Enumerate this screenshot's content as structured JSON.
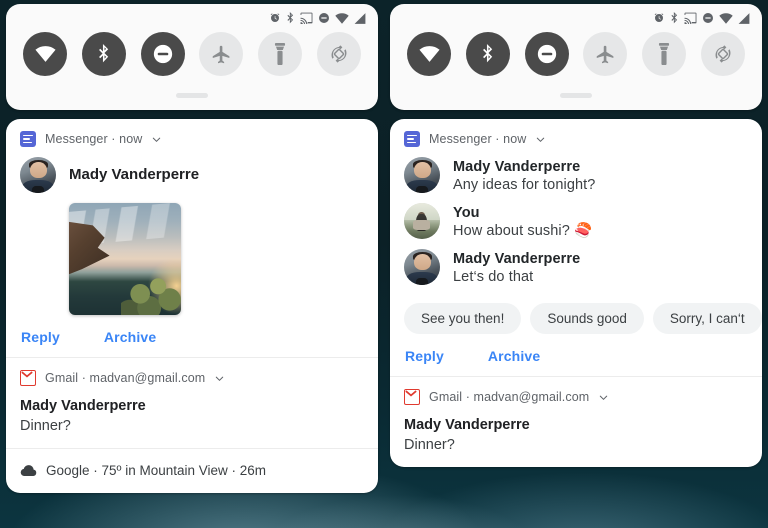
{
  "meta": {
    "accent_blue": "#3a85f6",
    "panel_bg": "#ffffff",
    "qs_bg": "#fafafa",
    "tile_on": "#4a4a4a",
    "tile_off": "#e6e7e8",
    "wallpaper": "#0b2227"
  },
  "statusbar": {
    "icons": [
      {
        "name": "alarm-icon",
        "label": "Alarm"
      },
      {
        "name": "bluetooth-icon",
        "label": "Bluetooth"
      },
      {
        "name": "cast-icon",
        "label": "Cast"
      },
      {
        "name": "do-not-disturb-icon",
        "label": "Do Not Disturb"
      },
      {
        "name": "wifi-icon",
        "label": "Wi-Fi"
      },
      {
        "name": "cell-signal-icon",
        "label": "Mobile signal"
      }
    ]
  },
  "quick_settings": {
    "tiles": [
      {
        "name": "wifi-tile",
        "label": "Wi-Fi",
        "state": "on"
      },
      {
        "name": "bluetooth-tile",
        "label": "Bluetooth",
        "state": "on"
      },
      {
        "name": "do-not-disturb-tile",
        "label": "Do Not Disturb",
        "state": "on"
      },
      {
        "name": "airplane-mode-tile",
        "label": "Airplane mode",
        "state": "off"
      },
      {
        "name": "flashlight-tile",
        "label": "Flashlight",
        "state": "off"
      },
      {
        "name": "auto-rotate-tile",
        "label": "Auto-rotate",
        "state": "off"
      }
    ],
    "drag_handle": "Expand quick settings"
  },
  "left_panel": {
    "messenger": {
      "app_name": "Messenger · now",
      "sender": "Mady Vanderperre",
      "attachment_alt": "Sunset over a cliff and valley",
      "actions": [
        {
          "name": "reply-action",
          "label": "Reply"
        },
        {
          "name": "archive-action",
          "label": "Archive"
        }
      ]
    },
    "gmail": {
      "app_name": "Gmail · madvan@gmail.com",
      "title": "Mady Vanderperre",
      "subject": "Dinner?"
    },
    "weather": {
      "text": "Google · 75º in Mountain View · 26m"
    }
  },
  "right_panel": {
    "messenger": {
      "app_name": "Messenger · now",
      "messages": [
        {
          "sender": "Mady Vanderperre",
          "body": "Any ideas for tonight?",
          "avatar": "mady"
        },
        {
          "sender": "You",
          "body": "How about sushi? 🍣",
          "avatar": "you"
        },
        {
          "sender": "Mady Vanderperre",
          "body": "Let‘s do that",
          "avatar": "mady"
        }
      ],
      "smart_replies": [
        {
          "name": "smart-reply-1",
          "label": "See you then!"
        },
        {
          "name": "smart-reply-2",
          "label": "Sounds good"
        },
        {
          "name": "smart-reply-3",
          "label": "Sorry, I can‘t"
        }
      ],
      "actions": [
        {
          "name": "reply-action",
          "label": "Reply"
        },
        {
          "name": "archive-action",
          "label": "Archive"
        }
      ]
    },
    "gmail": {
      "app_name": "Gmail · madvan@gmail.com",
      "title": "Mady Vanderperre",
      "subject": "Dinner?"
    }
  }
}
